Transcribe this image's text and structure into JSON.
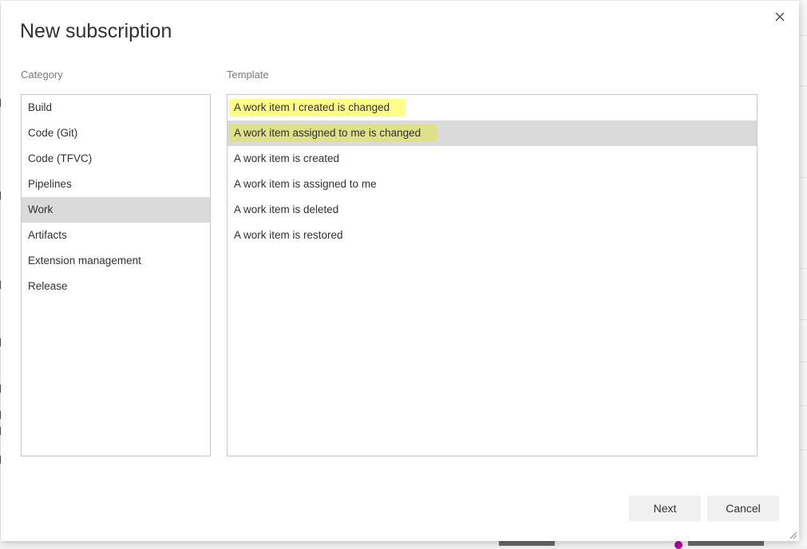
{
  "dialog": {
    "title": "New subscription",
    "close_icon": "close-icon"
  },
  "category": {
    "label": "Category",
    "selected": "Work",
    "items": [
      {
        "label": "Build"
      },
      {
        "label": "Code (Git)"
      },
      {
        "label": "Code (TFVC)"
      },
      {
        "label": "Pipelines"
      },
      {
        "label": "Work"
      },
      {
        "label": "Artifacts"
      },
      {
        "label": "Extension management"
      },
      {
        "label": "Release"
      }
    ]
  },
  "template": {
    "label": "Template",
    "selected": "A work item assigned to me is changed",
    "items": [
      {
        "label": "A work item I created is changed"
      },
      {
        "label": "A work item assigned to me is changed"
      },
      {
        "label": "A work item is created"
      },
      {
        "label": "A work item is assigned to me"
      },
      {
        "label": "A work item is deleted"
      },
      {
        "label": "A work item is restored"
      }
    ]
  },
  "footer": {
    "next_label": "Next",
    "cancel_label": "Cancel"
  },
  "colors": {
    "selected_row": "#dadada",
    "highlight_yellow": "#ffff88",
    "highlight_olive": "#dfe08a",
    "button_bg": "#f0f0f0"
  }
}
